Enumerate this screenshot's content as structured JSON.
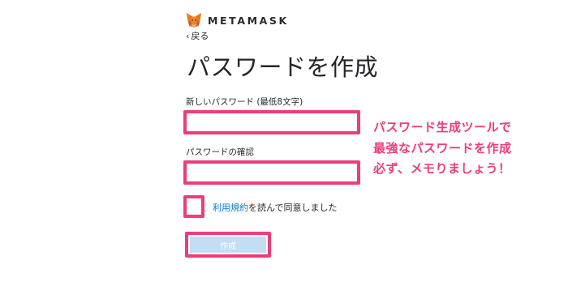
{
  "header": {
    "brand": "METAMASK",
    "back_label": "戻る",
    "back_icon": "chevron-left-icon"
  },
  "page": {
    "title": "パスワードを作成"
  },
  "form": {
    "password_label": "新しいパスワード (最低8文字)",
    "password_value": "",
    "confirm_label": "パスワードの確認",
    "confirm_value": "",
    "terms_link": "利用規約",
    "terms_text": "を読んで同意しました",
    "terms_checked": false,
    "create_label": "作成"
  },
  "annotation": {
    "lines": [
      "パスワード生成ツールで",
      "最強なパスワードを作成",
      "必ず、メモりましょう！"
    ],
    "color": "#ec3d7c"
  },
  "colors": {
    "highlight": "#ec3d7c",
    "link": "#037dd6",
    "button_disabled": "#c5dcf5"
  }
}
